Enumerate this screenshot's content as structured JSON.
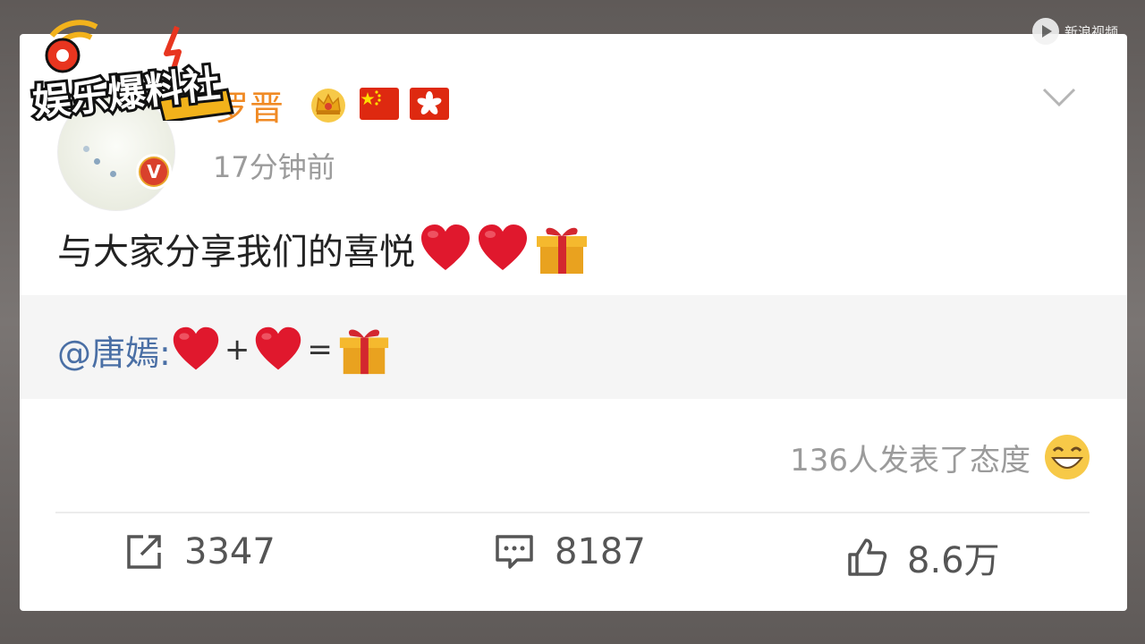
{
  "overlay": {
    "logo_text": "娱乐爆料社",
    "watermark": "新浪视频"
  },
  "post": {
    "username": "罗晋",
    "badges": [
      "crown-icon",
      "china-flag-icon",
      "hong-kong-flag-icon"
    ],
    "timestamp": "17分钟前",
    "text": "与大家分享我们的喜悦",
    "text_emojis": [
      "red-heart",
      "red-heart",
      "wrapped-gift"
    ],
    "verified": "V"
  },
  "quote": {
    "mention": "@唐嫣:",
    "plus": "+",
    "equals": "="
  },
  "reactions": {
    "text": "136人发表了态度",
    "emoji": "grinning-face"
  },
  "actions": {
    "repost_count": "3347",
    "comment_count": "8187",
    "like_count": "8.6万"
  },
  "colors": {
    "username": "#f08a24",
    "mention": "#4a6fa5",
    "quote_bg": "#f5f5f5"
  }
}
